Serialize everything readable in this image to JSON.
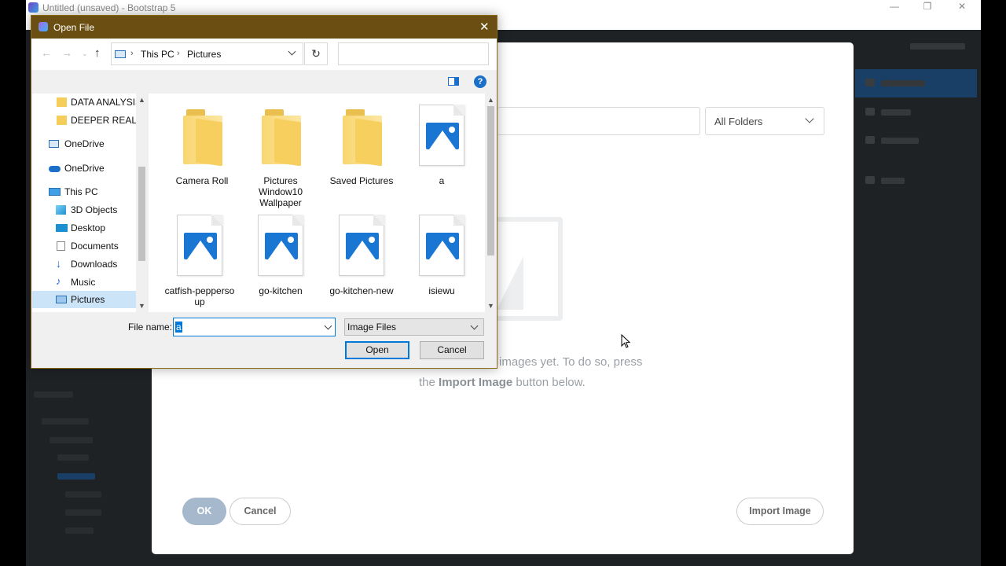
{
  "app": {
    "title": "Untitled (unsaved) - Bootstrap 5",
    "window_controls": {
      "minimize": "—",
      "restore": "❐",
      "close": "✕"
    }
  },
  "modal": {
    "folder_select": "All Folders",
    "empty_text_line1": "images yet. To do so, press",
    "empty_text_line2_prefix": "the",
    "empty_text_line2_bold": "Import Image",
    "empty_text_line2_suffix": "button below.",
    "ok_label": "OK",
    "cancel_label": "Cancel",
    "import_label": "Import Image"
  },
  "dialog": {
    "title": "Open File",
    "close": "✕",
    "address": {
      "segments": [
        "This PC",
        "Pictures"
      ]
    },
    "refresh": "↻",
    "help": "?",
    "nav_items": [
      {
        "label": "DATA ANALYSIS",
        "icon": "folder-icon"
      },
      {
        "label": "DEEPER REALMS",
        "icon": "folder-icon"
      },
      {
        "label": "OneDrive",
        "icon": "onedrive-icon"
      },
      {
        "label": "OneDrive",
        "icon": "cloud-icon"
      },
      {
        "label": "This PC",
        "icon": "computer-icon"
      },
      {
        "label": "3D Objects",
        "icon": "cube-icon"
      },
      {
        "label": "Desktop",
        "icon": "desktop-icon"
      },
      {
        "label": "Documents",
        "icon": "documents-icon"
      },
      {
        "label": "Downloads",
        "icon": "download-icon"
      },
      {
        "label": "Music",
        "icon": "music-icon"
      },
      {
        "label": "Pictures",
        "icon": "pictures-icon",
        "selected": true
      }
    ],
    "files": [
      {
        "label": "Camera Roll",
        "type": "folder"
      },
      {
        "label": "Pictures Window10 Wallpaper",
        "type": "folder"
      },
      {
        "label": "Saved Pictures",
        "type": "folder"
      },
      {
        "label": "a",
        "type": "image"
      },
      {
        "label": "catfish-peppersoup",
        "type": "image"
      },
      {
        "label": "go-kitchen",
        "type": "image"
      },
      {
        "label": "go-kitchen-new",
        "type": "image"
      },
      {
        "label": "isiewu",
        "type": "image"
      }
    ],
    "file_name_label": "File name:",
    "file_name_value": "a",
    "file_type": "Image Files",
    "open_label": "Open",
    "cancel_label": "Cancel"
  }
}
